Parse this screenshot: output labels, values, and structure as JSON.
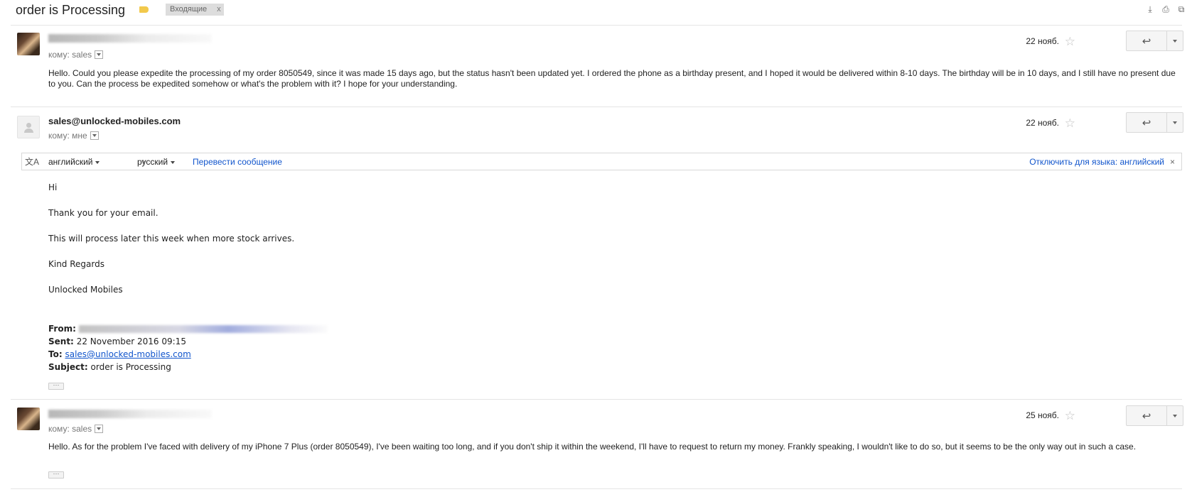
{
  "thread": {
    "subject": "order is Processing",
    "label_color": "#f2c94c",
    "inbox_chip": "Входящие",
    "chip_close": "x",
    "top_icons": [
      "download-icon",
      "print-icon",
      "new-window-icon"
    ]
  },
  "messages": [
    {
      "to_label": "кому: sales",
      "date": "22 нояб.",
      "body": "Hello. Could you please expedite the processing of my order 8050549, since it was made 15 days ago, but the status hasn't been updated yet. I ordered the phone as a birthday present, and I hoped it would be delivered within 8-10 days. The birthday will be in 10 days, and I still have no present due to you. Can the process be expedited somehow or what's the problem with it? I hope for your understanding."
    },
    {
      "sender": "sales@unlocked-mobiles.com",
      "to_label": "кому: мне",
      "date": "22 нояб.",
      "translate": {
        "from_lang": "английский",
        "arrow": "›",
        "to_lang": "русский",
        "translate_link": "Перевести сообщение",
        "disable_link": "Отключить для языка: английский",
        "close": "×"
      },
      "body_lines": [
        "Hi",
        "Thank you for your email.",
        "This will process later this week when more stock arrives.",
        "Kind Regards",
        "Unlocked Mobiles"
      ],
      "quoted": {
        "from_label": "From:",
        "sent_label": "Sent:",
        "sent_value": "22 November 2016 09:15",
        "to_label": "To:",
        "to_value": "sales@unlocked-mobiles.com",
        "subject_label": "Subject:",
        "subject_value": "order is Processing"
      }
    },
    {
      "to_label": "кому: sales",
      "date": "25 нояб.",
      "body": "Hello. As for the problem I've faced with delivery of my iPhone 7 Plus (order 8050549), I've been waiting too long, and if you don't ship it within the weekend, I'll have to request to return my money. Frankly speaking, I wouldn't like to do so, but it seems to be the only way out in such a case."
    }
  ],
  "ellipsis": "···",
  "reply_icon": "↩"
}
